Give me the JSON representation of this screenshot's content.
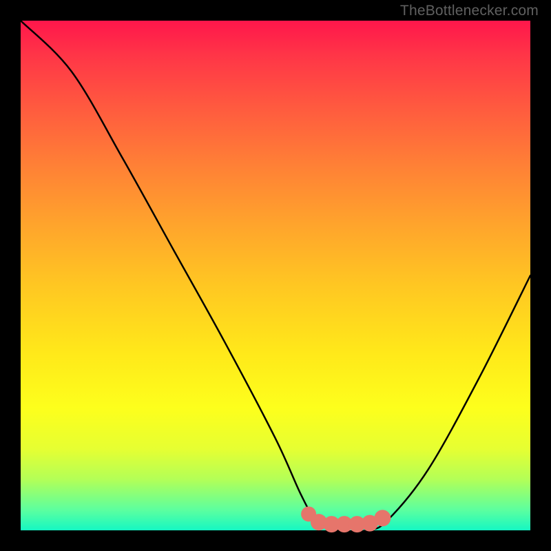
{
  "watermark": "TheBottlenecker.com",
  "chart_data": {
    "type": "line",
    "title": "",
    "xlabel": "",
    "ylabel": "",
    "xlim": [
      0,
      100
    ],
    "ylim": [
      0,
      100
    ],
    "series": [
      {
        "name": "bottleneck-curve",
        "x": [
          0,
          10,
          20,
          30,
          40,
          50,
          55,
          58,
          62,
          68,
          72,
          80,
          90,
          100
        ],
        "y": [
          100,
          90,
          73,
          55,
          37,
          18,
          7,
          2,
          0,
          0,
          2,
          12,
          30,
          50
        ]
      }
    ],
    "markers": [
      {
        "name": "optimal-start",
        "x": 56.5,
        "y": 3.2
      },
      {
        "name": "optimal-band-1",
        "x": 58.5,
        "y": 1.6
      },
      {
        "name": "optimal-band-2",
        "x": 61.0,
        "y": 1.2
      },
      {
        "name": "optimal-band-3",
        "x": 63.5,
        "y": 1.2
      },
      {
        "name": "optimal-band-4",
        "x": 66.0,
        "y": 1.2
      },
      {
        "name": "optimal-band-5",
        "x": 68.5,
        "y": 1.4
      },
      {
        "name": "optimal-end",
        "x": 71.0,
        "y": 2.4
      }
    ],
    "background_gradient": {
      "top": "#ff164b",
      "mid": "#ffe81a",
      "bottom": "#15f7c3"
    }
  }
}
